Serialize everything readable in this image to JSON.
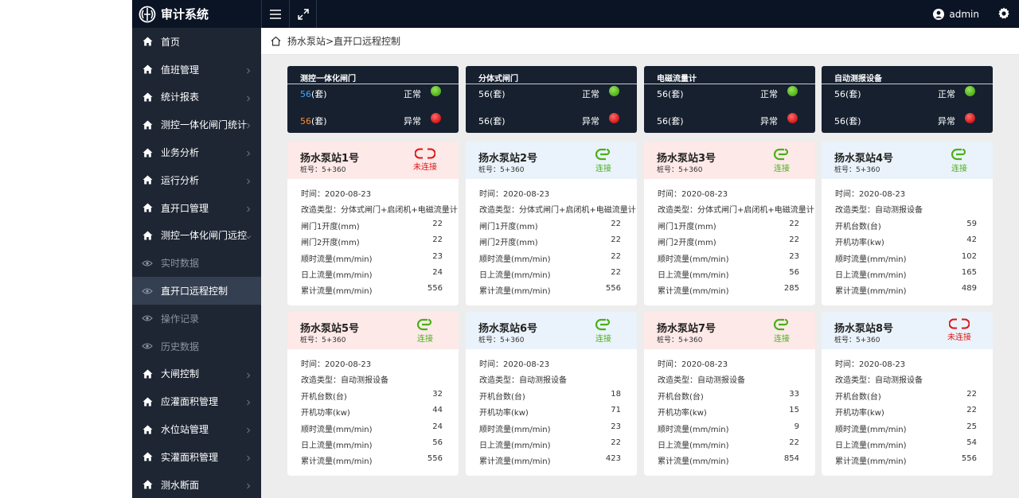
{
  "brand": {
    "title": "审计系统"
  },
  "header": {
    "user": "admin"
  },
  "sidebar": {
    "items": [
      {
        "label": "首页",
        "icon": "home-icon",
        "sub": false,
        "active": false,
        "chevron": "none"
      },
      {
        "label": "值班管理",
        "icon": "home-icon",
        "sub": false,
        "active": false,
        "chevron": "right"
      },
      {
        "label": "统计报表",
        "icon": "home-icon",
        "sub": false,
        "active": false,
        "chevron": "right"
      },
      {
        "label": "测控一体化闸门统计",
        "icon": "home-icon",
        "sub": false,
        "active": false,
        "chevron": "right"
      },
      {
        "label": "业务分析",
        "icon": "home-icon",
        "sub": false,
        "active": false,
        "chevron": "right"
      },
      {
        "label": "运行分析",
        "icon": "home-icon",
        "sub": false,
        "active": false,
        "chevron": "right"
      },
      {
        "label": "直开口管理",
        "icon": "home-icon",
        "sub": false,
        "active": false,
        "chevron": "right"
      },
      {
        "label": "测控一体化闸门远控",
        "icon": "home-icon",
        "sub": false,
        "active": false,
        "chevron": "down"
      },
      {
        "label": "实时数据",
        "icon": "eye-icon",
        "sub": true,
        "active": false,
        "chevron": "none"
      },
      {
        "label": "直开口远程控制",
        "icon": "eye-icon",
        "sub": true,
        "active": true,
        "chevron": "none"
      },
      {
        "label": "操作记录",
        "icon": "eye-icon",
        "sub": true,
        "active": false,
        "chevron": "none"
      },
      {
        "label": "历史数据",
        "icon": "eye-icon",
        "sub": true,
        "active": false,
        "chevron": "none"
      },
      {
        "label": "大闸控制",
        "icon": "home-icon",
        "sub": false,
        "active": false,
        "chevron": "right"
      },
      {
        "label": "应灌面积管理",
        "icon": "home-icon",
        "sub": false,
        "active": false,
        "chevron": "right"
      },
      {
        "label": "水位站管理",
        "icon": "home-icon",
        "sub": false,
        "active": false,
        "chevron": "right"
      },
      {
        "label": "实灌面积管理",
        "icon": "home-icon",
        "sub": false,
        "active": false,
        "chevron": "right"
      },
      {
        "label": "测水断面",
        "icon": "home-icon",
        "sub": false,
        "active": false,
        "chevron": "right"
      }
    ]
  },
  "breadcrumb": {
    "text": "扬水泵站>直开口远程控制"
  },
  "summary": [
    {
      "title": "测控一体化闸门",
      "rows": [
        {
          "count": "56",
          "unit": "(套)",
          "countColor": "blue",
          "status": "正常",
          "dot": "green"
        },
        {
          "count": "56",
          "unit": "(套)",
          "countColor": "orange",
          "status": "异常",
          "dot": "red"
        }
      ]
    },
    {
      "title": "分体式闸门",
      "rows": [
        {
          "count": "56",
          "unit": "(套)",
          "countColor": "",
          "status": "正常",
          "dot": "green"
        },
        {
          "count": "56",
          "unit": "(套)",
          "countColor": "",
          "status": "异常",
          "dot": "red"
        }
      ]
    },
    {
      "title": "电磁流量计",
      "rows": [
        {
          "count": "56",
          "unit": "(套)",
          "countColor": "",
          "status": "正常",
          "dot": "green"
        },
        {
          "count": "56",
          "unit": "(套)",
          "countColor": "",
          "status": "异常",
          "dot": "red"
        }
      ]
    },
    {
      "title": "自动测报设备",
      "rows": [
        {
          "count": "56",
          "unit": "(套)",
          "countColor": "",
          "status": "正常",
          "dot": "green"
        },
        {
          "count": "56",
          "unit": "(套)",
          "countColor": "",
          "status": "异常",
          "dot": "red"
        }
      ]
    }
  ],
  "stations": [
    {
      "name": "扬水泵站1号",
      "pile": "桩号：5+360",
      "connected": false,
      "conn_label": "未连接",
      "header": "red",
      "rows": [
        {
          "k": "时间：2020-08-23",
          "v": ""
        },
        {
          "k": "改造类型：分体式闸门+启闭机+电磁流量计",
          "v": ""
        },
        {
          "k": "闸门1开度(mm)",
          "v": "22"
        },
        {
          "k": "闸门2开度(mm)",
          "v": "22"
        },
        {
          "k": "顺时流量(mm/min)",
          "v": "23"
        },
        {
          "k": "日上流量(mm/min)",
          "v": "24"
        },
        {
          "k": "累计流量(mm/min)",
          "v": "556"
        }
      ]
    },
    {
      "name": "扬水泵站2号",
      "pile": "桩号：5+360",
      "connected": true,
      "conn_label": "连接",
      "header": "blue",
      "rows": [
        {
          "k": "时间：2020-08-23",
          "v": ""
        },
        {
          "k": "改造类型：分体式闸门+启闭机+电磁流量计",
          "v": ""
        },
        {
          "k": "闸门1开度(mm)",
          "v": "22"
        },
        {
          "k": "闸门2开度(mm)",
          "v": "22"
        },
        {
          "k": "顺时流量(mm/min)",
          "v": "22"
        },
        {
          "k": "日上流量(mm/min)",
          "v": "22"
        },
        {
          "k": "累计流量(mm/min)",
          "v": "556"
        }
      ]
    },
    {
      "name": "扬水泵站3号",
      "pile": "桩号：5+360",
      "connected": true,
      "conn_label": "连接",
      "header": "red",
      "rows": [
        {
          "k": "时间：2020-08-23",
          "v": ""
        },
        {
          "k": "改造类型：分体式闸门+启闭机+电磁流量计",
          "v": ""
        },
        {
          "k": "闸门1开度(mm)",
          "v": "22"
        },
        {
          "k": "闸门2开度(mm)",
          "v": "22"
        },
        {
          "k": "顺时流量(mm/min)",
          "v": "23"
        },
        {
          "k": "日上流量(mm/min)",
          "v": "56"
        },
        {
          "k": "累计流量(mm/min)",
          "v": "285"
        }
      ]
    },
    {
      "name": "扬水泵站4号",
      "pile": "桩号：5+360",
      "connected": true,
      "conn_label": "连接",
      "header": "blue",
      "rows": [
        {
          "k": "时间：2020-08-23",
          "v": ""
        },
        {
          "k": "改造类型：自动测报设备",
          "v": ""
        },
        {
          "k": "开机台数(台)",
          "v": "59"
        },
        {
          "k": "开机功率(kw)",
          "v": "42"
        },
        {
          "k": "顺时流量(mm/min)",
          "v": "102"
        },
        {
          "k": "日上流量(mm/min)",
          "v": "165"
        },
        {
          "k": "累计流量(mm/min)",
          "v": "489"
        }
      ]
    },
    {
      "name": "扬水泵站5号",
      "pile": "桩号：5+360",
      "connected": true,
      "conn_label": "连接",
      "header": "red",
      "rows": [
        {
          "k": "时间：2020-08-23",
          "v": ""
        },
        {
          "k": "改造类型：自动测报设备",
          "v": ""
        },
        {
          "k": "开机台数(台)",
          "v": "32"
        },
        {
          "k": "开机功率(kw)",
          "v": "44"
        },
        {
          "k": "顺时流量(mm/min)",
          "v": "24"
        },
        {
          "k": "日上流量(mm/min)",
          "v": "56"
        },
        {
          "k": "累计流量(mm/min)",
          "v": "556"
        }
      ]
    },
    {
      "name": "扬水泵站6号",
      "pile": "桩号：5+360",
      "connected": true,
      "conn_label": "连接",
      "header": "blue",
      "rows": [
        {
          "k": "时间：2020-08-23",
          "v": ""
        },
        {
          "k": "改造类型：自动测报设备",
          "v": ""
        },
        {
          "k": "开机台数(台)",
          "v": "18"
        },
        {
          "k": "开机功率(kw)",
          "v": "71"
        },
        {
          "k": "顺时流量(mm/min)",
          "v": "23"
        },
        {
          "k": "日上流量(mm/min)",
          "v": "22"
        },
        {
          "k": "累计流量(mm/min)",
          "v": "423"
        }
      ]
    },
    {
      "name": "扬水泵站7号",
      "pile": "桩号：5+360",
      "connected": true,
      "conn_label": "连接",
      "header": "red",
      "rows": [
        {
          "k": "时间：2020-08-23",
          "v": ""
        },
        {
          "k": "改造类型：自动测报设备",
          "v": ""
        },
        {
          "k": "开机台数(台)",
          "v": "33"
        },
        {
          "k": "开机功率(kw)",
          "v": "15"
        },
        {
          "k": "顺时流量(mm/min)",
          "v": "9"
        },
        {
          "k": "日上流量(mm/min)",
          "v": "22"
        },
        {
          "k": "累计流量(mm/min)",
          "v": "854"
        }
      ]
    },
    {
      "name": "扬水泵站8号",
      "pile": "桩号：5+360",
      "connected": false,
      "conn_label": "未连接",
      "header": "blue",
      "rows": [
        {
          "k": "时间：2020-08-23",
          "v": ""
        },
        {
          "k": "改造类型：自动测报设备",
          "v": ""
        },
        {
          "k": "开机台数(台)",
          "v": "22"
        },
        {
          "k": "开机功率(kw)",
          "v": "22"
        },
        {
          "k": "顺时流量(mm/min)",
          "v": "25"
        },
        {
          "k": "日上流量(mm/min)",
          "v": "54"
        },
        {
          "k": "累计流量(mm/min)",
          "v": "556"
        }
      ]
    }
  ],
  "colors": {
    "topbar": "#0a1425",
    "sidebar": "#1e2634",
    "active": "#343f51",
    "ok": "#4caf1b",
    "bad": "#e01515"
  }
}
